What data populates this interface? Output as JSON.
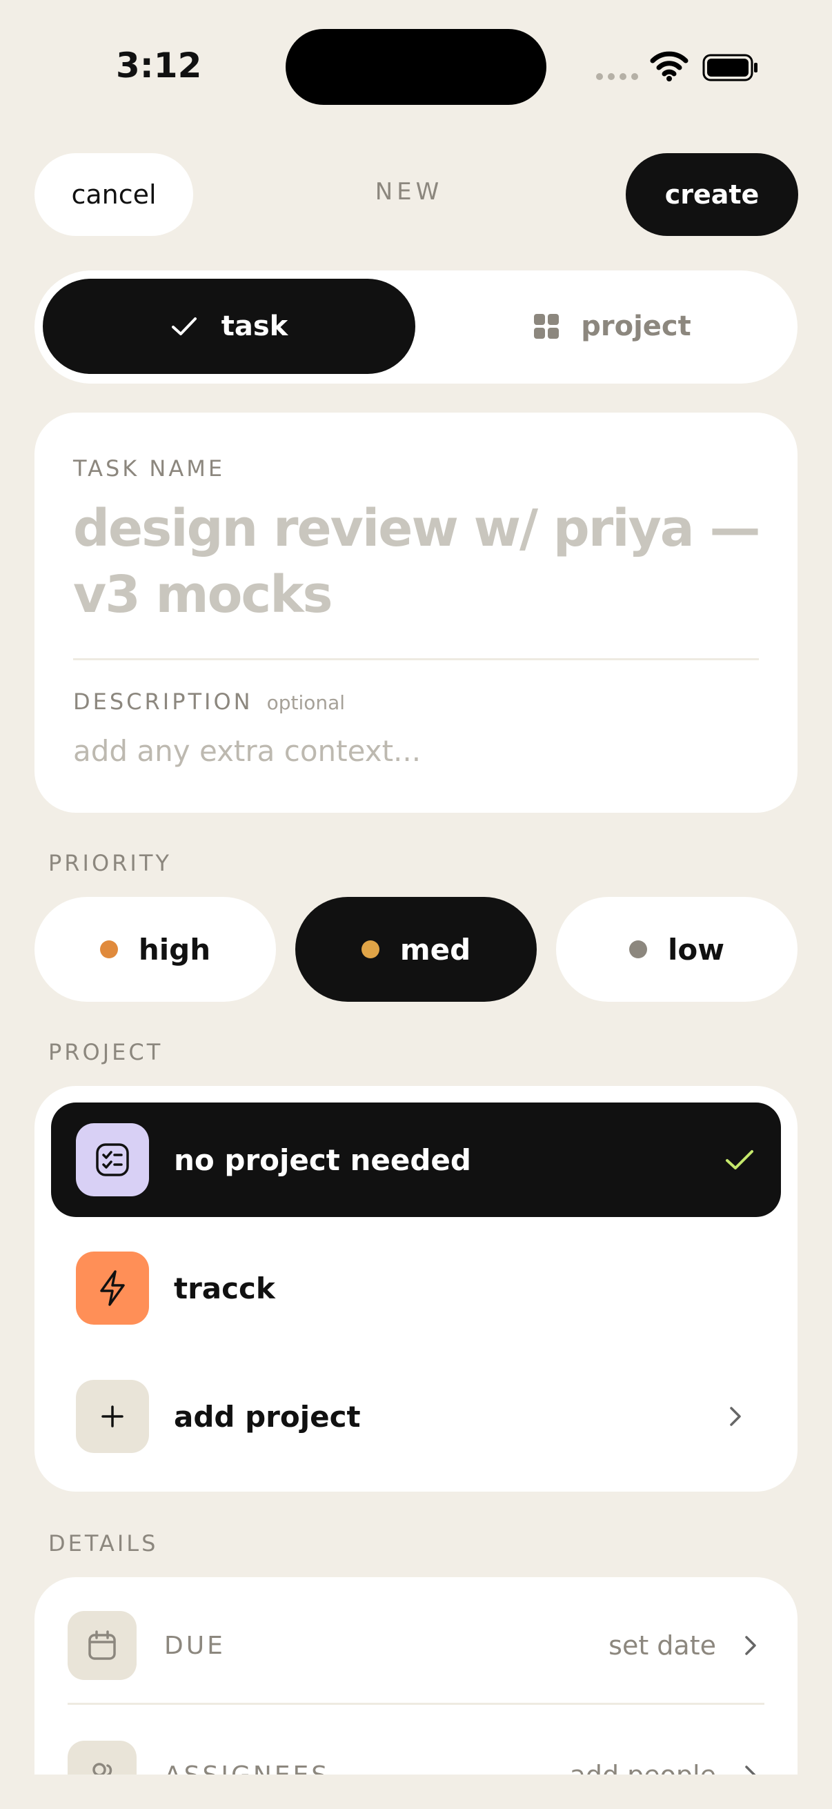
{
  "status_bar": {
    "time": "3:12"
  },
  "header": {
    "cancel_label": "cancel",
    "title": "NEW",
    "create_label": "create"
  },
  "type_toggle": {
    "options": [
      {
        "label": "task",
        "icon": "check-icon",
        "selected": true
      },
      {
        "label": "project",
        "icon": "grid-icon",
        "selected": false
      }
    ]
  },
  "task_form": {
    "name_label": "TASK NAME",
    "name_placeholder": "design review w/ priya — v3 mocks",
    "description_label": "DESCRIPTION",
    "description_optional": "optional",
    "description_placeholder": "add any extra context..."
  },
  "priority": {
    "label": "PRIORITY",
    "options": [
      {
        "label": "high",
        "color": "#E08A3C",
        "selected": false
      },
      {
        "label": "med",
        "color": "#E0A447",
        "selected": true
      },
      {
        "label": "low",
        "color": "#8C877E",
        "selected": false
      }
    ]
  },
  "project": {
    "label": "PROJECT",
    "items": [
      {
        "name": "no project needed",
        "icon": "checklist-icon",
        "icon_bg": "#D8D0F5",
        "selected": true
      },
      {
        "name": "tracck",
        "icon": "lightning-icon",
        "icon_bg": "#FF8F57",
        "selected": false
      },
      {
        "name": "add project",
        "icon": "plus-icon",
        "icon_bg": "#E9E4D8",
        "selected": false
      }
    ]
  },
  "details": {
    "label": "DETAILS",
    "rows": [
      {
        "label": "DUE",
        "value": "set date",
        "icon": "calendar-icon"
      },
      {
        "label": "ASSIGNEES",
        "value": "add people",
        "icon": "people-icon"
      }
    ]
  },
  "colors": {
    "background": "#F2EEE6",
    "dark": "#111111",
    "muted": "#8C877E",
    "check_accent": "#C5E86C"
  }
}
